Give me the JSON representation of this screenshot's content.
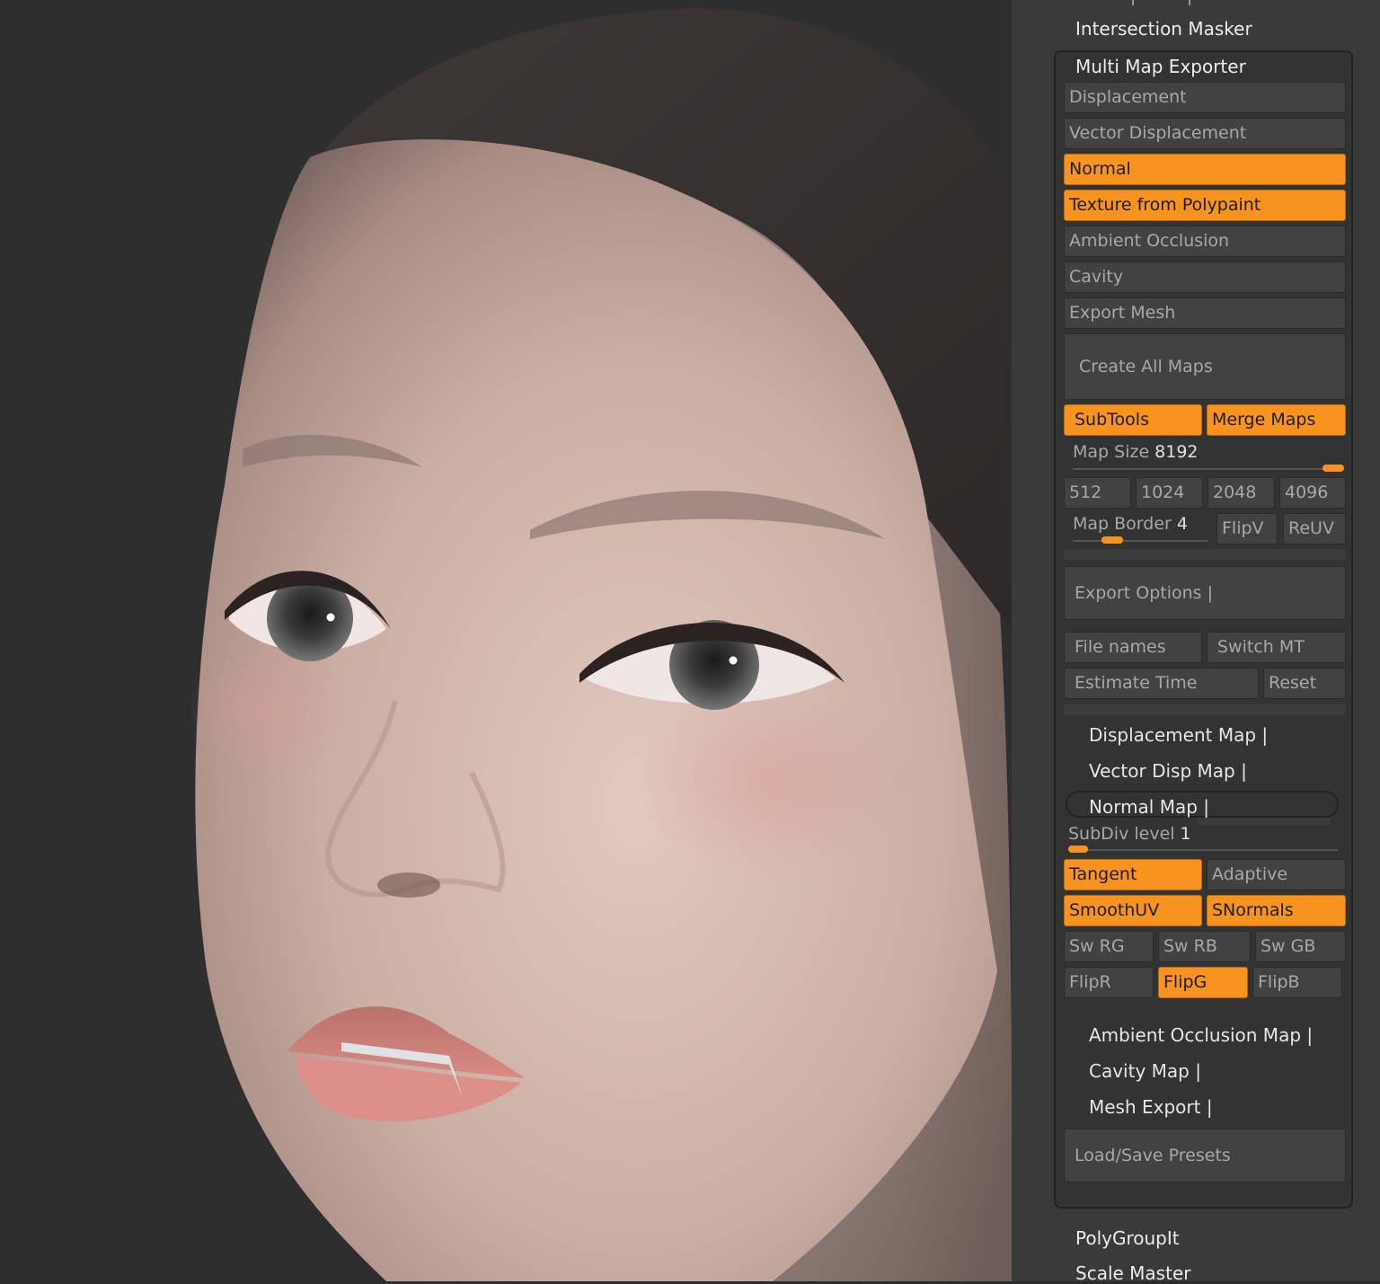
{
  "palette": {
    "intersection_masker": "Intersection Masker",
    "multi_map_exporter": {
      "title": "Multi Map Exporter",
      "map_toggles": {
        "displacement": "Displacement",
        "vector_displacement": "Vector Displacement",
        "normal": "Normal",
        "texture_from_polypaint": "Texture from Polypaint",
        "ambient_occlusion": "Ambient Occlusion",
        "cavity": "Cavity",
        "export_mesh": "Export Mesh"
      },
      "active_toggles": [
        "Normal",
        "Texture from Polypaint",
        "SubTools",
        "Merge Maps",
        "Tangent",
        "SmoothUV",
        "SNormals",
        "FlipG"
      ],
      "create_all_maps": "Create All Maps",
      "subtools": "SubTools",
      "merge_maps": "Merge Maps",
      "map_size": {
        "label": "Map Size",
        "value": "8192",
        "level": 1.0
      },
      "size_presets": [
        "512",
        "1024",
        "2048",
        "4096"
      ],
      "map_border": {
        "label": "Map Border",
        "value": "4",
        "level": 0.25
      },
      "flipv": "FlipV",
      "reuv": "ReUV",
      "export_options": "Export Options",
      "file_names": "File names",
      "switch_mt": "Switch MT",
      "estimate_time": "Estimate Time",
      "reset": "Reset",
      "displacement_map": "Displacement Map",
      "vector_disp_map": "Vector Disp Map",
      "normal_map": "Normal Map",
      "subdiv_level": {
        "label": "SubDiv level",
        "value": "1",
        "level": 0.0
      },
      "tangent": "Tangent",
      "adaptive": "Adaptive",
      "smoothuv": "SmoothUV",
      "snormals": "SNormals",
      "sw_rg": "Sw RG",
      "sw_rb": "Sw RB",
      "sw_gb": "Sw GB",
      "flipr": "FlipR",
      "flipg": "FlipG",
      "flipb": "FlipB",
      "ambient_occlusion_map": "Ambient Occlusion Map",
      "cavity_map": "Cavity Map",
      "mesh_export": "Mesh Export",
      "load_save_presets": "Load/Save Presets"
    },
    "polygroupit": "PolyGroupIt",
    "scale_master": "Scale Master",
    "accent_color": "#f7931e"
  },
  "viewport": {
    "subject": "sculpted-head-render",
    "icon": "3d-head-model"
  }
}
